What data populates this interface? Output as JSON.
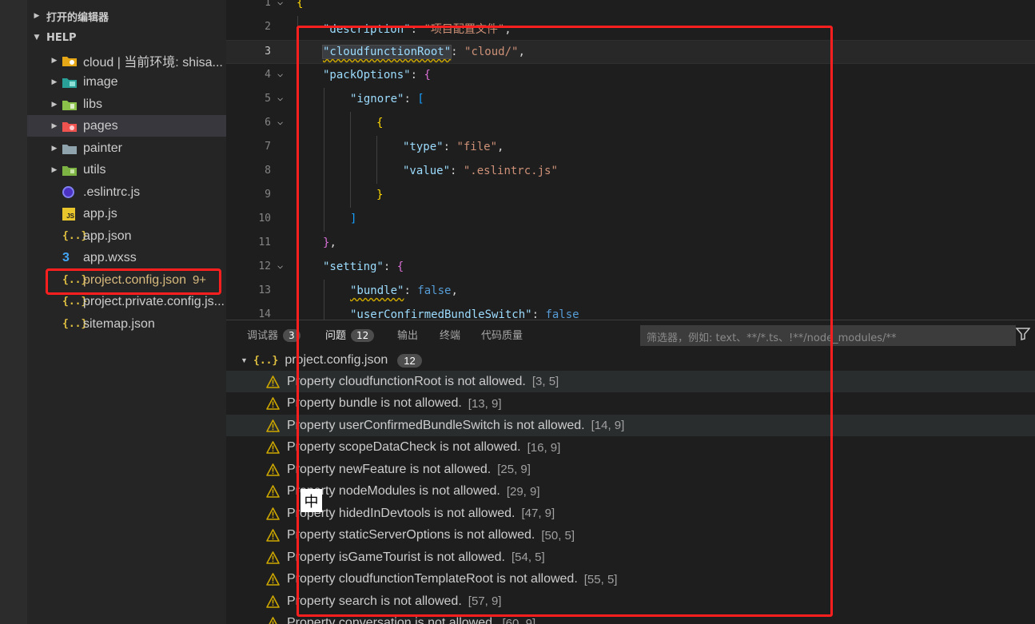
{
  "sidebar": {
    "open_editors_label": "打开的编辑器",
    "workspace_label": "HELP",
    "items": [
      {
        "label": "cloud | 当前环境: shisa...",
        "icon": "cloud-folder-icon"
      },
      {
        "label": "image",
        "icon": "image-folder-icon"
      },
      {
        "label": "libs",
        "icon": "libs-folder-icon"
      },
      {
        "label": "pages",
        "icon": "pages-folder-icon"
      },
      {
        "label": "painter",
        "icon": "folder-icon"
      },
      {
        "label": "utils",
        "icon": "utils-folder-icon"
      },
      {
        "label": ".eslintrc.js",
        "icon": "eslint-icon"
      },
      {
        "label": "app.js",
        "icon": "js-file-icon"
      },
      {
        "label": "app.json",
        "icon": "json-file-icon"
      },
      {
        "label": "app.wxss",
        "icon": "css-file-icon"
      },
      {
        "label": "project.config.json",
        "icon": "json-file-icon",
        "badge": "9+"
      },
      {
        "label": "project.private.config.js...",
        "icon": "json-file-icon"
      },
      {
        "label": "sitemap.json",
        "icon": "json-file-icon"
      }
    ]
  },
  "editor": {
    "line_numbers": [
      "1",
      "2",
      "3",
      "4",
      "5",
      "6",
      "7",
      "8",
      "9",
      "10",
      "11",
      "12",
      "13",
      "14"
    ],
    "tokens": {
      "description_key": "\"description\"",
      "description_val": "\"项目配置文件\"",
      "cloudfunctionRoot_key": "\"cloudfunctionRoot\"",
      "cloudfunctionRoot_val": "\"cloud/\"",
      "packOptions_key": "\"packOptions\"",
      "ignore_key": "\"ignore\"",
      "type_key": "\"type\"",
      "type_val": "\"file\"",
      "value_key": "\"value\"",
      "value_val": "\".eslintrc.js\"",
      "setting_key": "\"setting\"",
      "bundle_key": "\"bundle\"",
      "false_val": "false",
      "userConfirmed_key": "\"userConfirmedBundleSwitch\""
    }
  },
  "panel": {
    "tabs": [
      {
        "label": "调试器",
        "count": "3"
      },
      {
        "label": "问题",
        "count": "12"
      },
      {
        "label": "输出"
      },
      {
        "label": "终端"
      },
      {
        "label": "代码质量"
      }
    ],
    "filter_placeholder": "筛选器，例如: text、**/*.ts、!**/node_modules/**",
    "file_group": {
      "name": "project.config.json",
      "count": "12"
    },
    "problems": [
      {
        "message": "Property cloudfunctionRoot is not allowed.",
        "location": "[3, 5]"
      },
      {
        "message": "Property bundle is not allowed.",
        "location": "[13, 9]"
      },
      {
        "message": "Property userConfirmedBundleSwitch is not allowed.",
        "location": "[14, 9]"
      },
      {
        "message": "Property scopeDataCheck is not allowed.",
        "location": "[16, 9]"
      },
      {
        "message": "Property newFeature is not allowed.",
        "location": "[25, 9]"
      },
      {
        "message": "Property nodeModules is not allowed.",
        "location": "[29, 9]"
      },
      {
        "message": "Property hidedInDevtools is not allowed.",
        "location": "[47, 9]"
      },
      {
        "message": "Property staticServerOptions is not allowed.",
        "location": "[50, 5]"
      },
      {
        "message": "Property isGameTourist is not allowed.",
        "location": "[54, 5]"
      },
      {
        "message": "Property cloudfunctionTemplateRoot is not allowed.",
        "location": "[55, 5]"
      },
      {
        "message": "Property search is not allowed.",
        "location": "[57, 9]"
      },
      {
        "message": "Property conversation is not allowed.",
        "location": "[60, 9]"
      }
    ]
  },
  "ime_indicator": "中",
  "colors": {
    "annotation_red": "#ff1f1f",
    "warning_yellow": "#cca700",
    "json_key": "#9cdcfe",
    "json_string": "#ce9178"
  }
}
